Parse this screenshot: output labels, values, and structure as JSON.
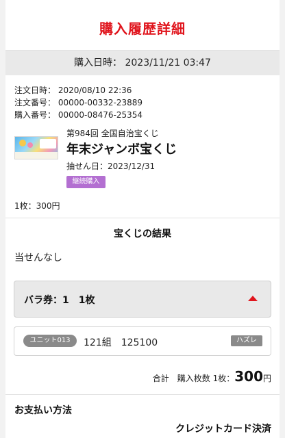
{
  "header": {
    "title": "購入履歴詳細"
  },
  "purchase": {
    "datetime": "購入日時： 2023/11/21 03:47"
  },
  "order": {
    "order_date_label": "注文日時：",
    "order_date": "2020/08/10 22:36",
    "order_no_label": "注文番号：",
    "order_no": "00000-00332-23889",
    "purchase_no_label": "購入番号：",
    "purchase_no": "00000-08476-25354"
  },
  "lottery": {
    "subtitle": "第984回 全国自治宝くじ",
    "name": "年末ジャンボ宝くじ",
    "draw_date": "抽せん日：2023/12/31",
    "badge": "継続購入",
    "qty_price": "1枚：300円"
  },
  "results": {
    "title": "宝くじの結果",
    "status": "当せんなし"
  },
  "bara": {
    "label": "バラ券：1　1枚",
    "expanded": true,
    "accent_color": "#e0151d"
  },
  "unit": {
    "name": "ユニット013",
    "number": "121組　125100",
    "result": "ハズレ"
  },
  "total": {
    "label": "合計　購入枚数 1枚：",
    "amount": "300",
    "currency": "円"
  },
  "payment": {
    "title": "お支払い方法",
    "method": "クレジットカード決済"
  },
  "colors": {
    "title_red": "#e0151d",
    "badge_purple": "#b36fd1",
    "gray_pill": "#8a8a8a"
  }
}
